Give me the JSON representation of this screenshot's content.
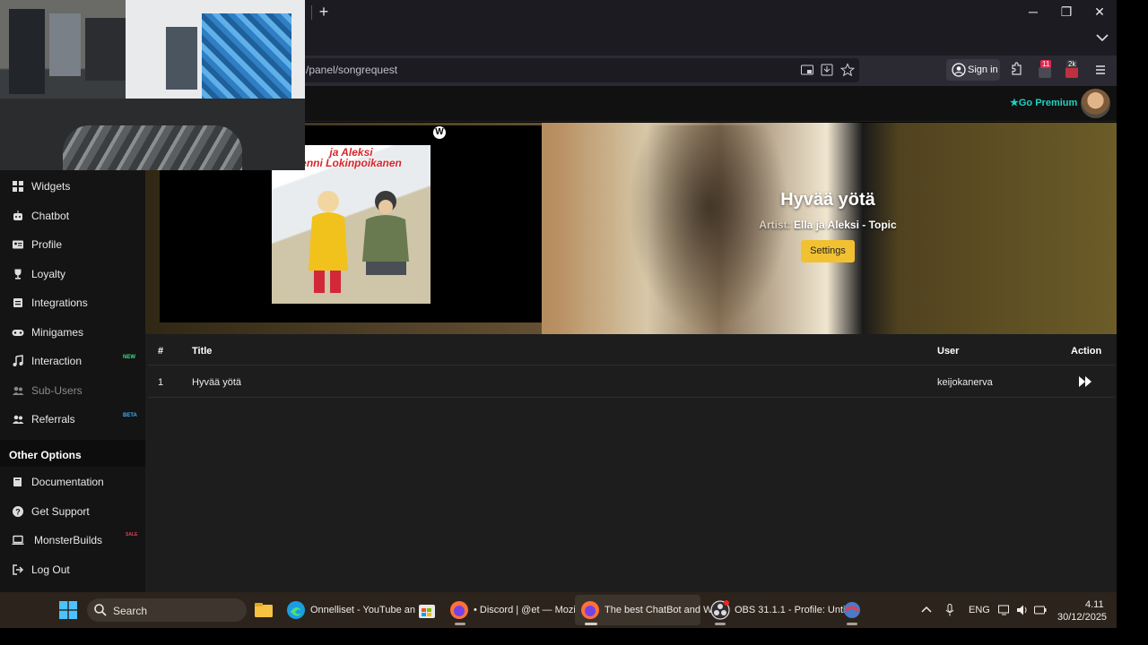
{
  "browser": {
    "new_tab_label": "+",
    "url": "/panel/songrequest",
    "sign_in": "Sign in",
    "ext_badge_1": "11",
    "ext_badge_2": "2k",
    "minimize": "─",
    "maximize": "❐",
    "close": "✕"
  },
  "header": {
    "premium": "Go Premium"
  },
  "sidebar": {
    "items": [
      {
        "label": "Widgets",
        "icon": "grid-icon"
      },
      {
        "label": "Chatbot",
        "icon": "robot-icon"
      },
      {
        "label": "Profile",
        "icon": "id-card-icon"
      },
      {
        "label": "Loyalty",
        "icon": "trophy-icon"
      },
      {
        "label": "Integrations",
        "icon": "plug-icon"
      },
      {
        "label": "Minigames",
        "icon": "gamepad-icon"
      },
      {
        "label": "Interaction",
        "icon": "music-icon",
        "tag": "NEW"
      },
      {
        "label": "Sub-Users",
        "icon": "users-icon"
      },
      {
        "label": "Referrals",
        "icon": "users-icon",
        "tag": "BETA"
      }
    ],
    "other_options_heading": "Other Options",
    "other_items": [
      {
        "label": "Documentation",
        "icon": "book-icon"
      },
      {
        "label": "Get Support",
        "icon": "question-icon"
      },
      {
        "label": "MonsterBuilds",
        "icon": "laptop-icon",
        "tag": "SALE"
      },
      {
        "label": "Log Out",
        "icon": "logout-icon"
      }
    ]
  },
  "player": {
    "album_title_line1": "ja Aleksi",
    "album_title_line2": "enni Lokinpoikanen",
    "song_title": "Hyvää yötä",
    "artist_key": "Artist:",
    "artist_value": "Ella ja Aleksi - Topic",
    "settings_button": "Settings",
    "wm_logo": "W"
  },
  "queue": {
    "columns": [
      "#",
      "Title",
      "User",
      "Action"
    ],
    "rows": [
      {
        "num": "1",
        "title": "Hyvää yötä",
        "user": "keijokanerva"
      }
    ]
  },
  "taskbar": {
    "search": "Search",
    "apps": [
      {
        "label": "Onnelliset - YouTube an",
        "icon": "edge-icon"
      },
      {
        "label": "• Discord | @et — Mozil",
        "icon": "firefox-icon"
      },
      {
        "label": "The best ChatBot and W",
        "icon": "firefox-icon"
      },
      {
        "label": "OBS 31.1.1 - Profile: Unti",
        "icon": "obs-icon"
      }
    ],
    "lang": "ENG",
    "time": "4.11",
    "date": "30/12/2025"
  },
  "colors": {
    "accent_teal": "#1fd1c3",
    "settings_yellow": "#f2c132",
    "sidebar_bg": "#141414",
    "main_bg": "#1d1d1d"
  }
}
